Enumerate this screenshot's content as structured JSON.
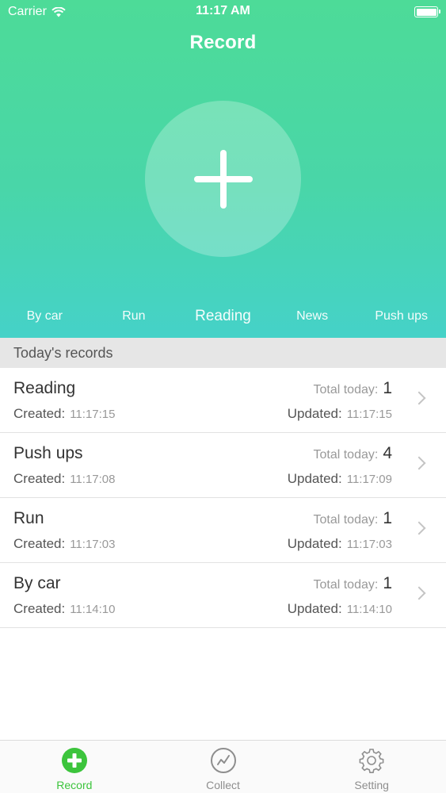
{
  "status_bar": {
    "carrier": "Carrier",
    "time": "11:17 AM"
  },
  "nav": {
    "title": "Record"
  },
  "categories": [
    {
      "label": "By car"
    },
    {
      "label": "Run"
    },
    {
      "label": "Reading",
      "selected": true
    },
    {
      "label": "News"
    },
    {
      "label": "Push ups"
    }
  ],
  "section": {
    "title": "Today's records"
  },
  "labels": {
    "created": "Created:",
    "updated": "Updated:",
    "total_today": "Total today:"
  },
  "records": [
    {
      "name": "Reading",
      "total": "1",
      "created": "11:17:15",
      "updated": "11:17:15"
    },
    {
      "name": "Push ups",
      "total": "4",
      "created": "11:17:08",
      "updated": "11:17:09"
    },
    {
      "name": "Run",
      "total": "1",
      "created": "11:17:03",
      "updated": "11:17:03"
    },
    {
      "name": "By car",
      "total": "1",
      "created": "11:14:10",
      "updated": "11:14:10"
    }
  ],
  "tabs": [
    {
      "label": "Record",
      "icon": "plus-circle-icon",
      "active": true
    },
    {
      "label": "Collect",
      "icon": "chart-circle-icon"
    },
    {
      "label": "Setting",
      "icon": "gear-icon"
    }
  ],
  "colors": {
    "accent_green": "#3cc43c",
    "header_top": "#4ddb98",
    "header_bottom": "#45d2c8"
  }
}
